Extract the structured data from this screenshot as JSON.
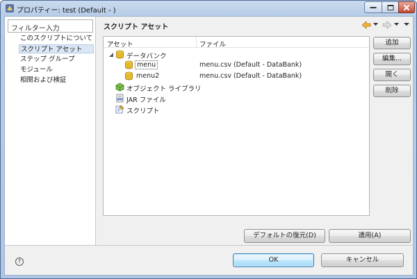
{
  "window": {
    "title": "プロパティー: test (Default - )"
  },
  "left_panel": {
    "filter_placeholder": "フィルター入力",
    "nav_items": [
      {
        "label": "このスクリプトについて",
        "selected": false
      },
      {
        "label": "スクリプト アセット",
        "selected": true
      },
      {
        "label": "ステップ グループ",
        "selected": false
      },
      {
        "label": "モジュール",
        "selected": false
      },
      {
        "label": "相関および検証",
        "selected": false
      }
    ]
  },
  "right_panel": {
    "title": "スクリプト アセット",
    "columns": [
      "アセット",
      "ファイル"
    ],
    "tree": [
      {
        "label": "データバンク",
        "file": "",
        "icon": "databank-icon",
        "expanded": true
      },
      {
        "label": "menu",
        "file": "menu.csv (Default - DataBank)",
        "icon": "database-icon",
        "selected": true
      },
      {
        "label": "menu2",
        "file": "menu.csv (Default - DataBank)",
        "icon": "database-icon"
      },
      {
        "label": "オブジェクト ライブラリ",
        "file": "",
        "icon": "object-library-icon"
      },
      {
        "label": "JAR ファイル",
        "file": "",
        "icon": "jar-file-icon"
      },
      {
        "label": "スクリプト",
        "file": "",
        "icon": "script-icon"
      }
    ],
    "side_buttons": {
      "add": "追加",
      "edit": "編集...",
      "open": "開く",
      "delete": "削除"
    },
    "restore_defaults": "デフォルトの復元(D)",
    "apply": "適用(A)"
  },
  "footer": {
    "ok": "OK",
    "cancel": "キャンセル",
    "help": "?"
  },
  "colors": {
    "title_bar": "#b7cde7",
    "dialog_bg": "#f0f0f0",
    "selection": "#dbe7f5",
    "default_button": "#3c7fb1"
  }
}
